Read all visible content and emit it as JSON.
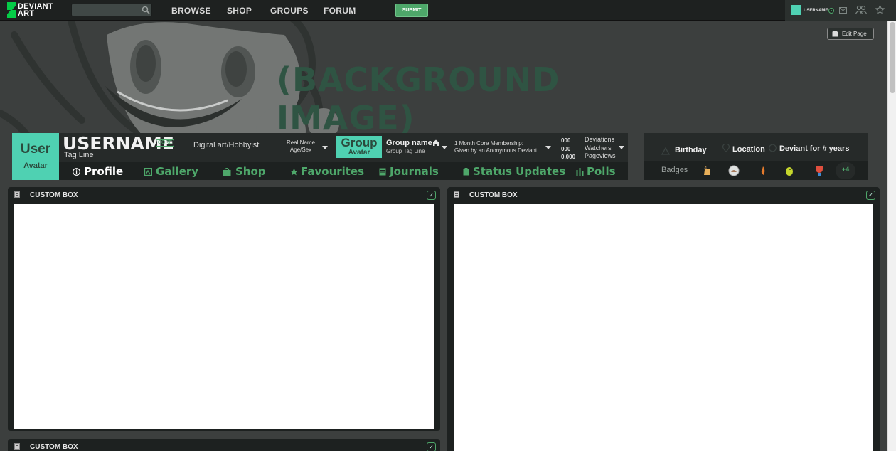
{
  "topbar": {
    "logo_line1": "DEVIANT",
    "logo_line2": "ART",
    "search_placeholder": "",
    "nav": [
      "BROWSE",
      "SHOP",
      "GROUPS",
      "FORUM"
    ],
    "submit": "SUBMIT",
    "username": "USERNAME",
    "icons": [
      "search-icon",
      "mail-icon",
      "watch-icon",
      "star-icon"
    ],
    "accent": "#4ea76a"
  },
  "banner": {
    "text": "(BACKGROUND IMAGE)",
    "edit_page": "Edit Page"
  },
  "profile": {
    "avatar_line1": "User",
    "avatar_line2": "Avatar",
    "username": "USERNAME",
    "core_badge": "CORE",
    "tagline": "Tag Line",
    "art_status": "Digital art/Hobbyist",
    "real_name": "Real Name",
    "age_sex": "Age/Sex",
    "group_avatar_line1": "Group",
    "group_avatar_line2": "Avatar",
    "group_name": "Group name",
    "group_tagline": "Group Tag Line",
    "membership_line1": "1 Month Core Membership:",
    "membership_line2": "Given by an Anonymous Deviant",
    "stats": [
      {
        "value": "000",
        "label": "Deviations"
      },
      {
        "value": "000",
        "label": "Watchers"
      },
      {
        "value": "0,000",
        "label": "Pageviews"
      }
    ],
    "tabs": [
      "Profile",
      "Gallery",
      "Shop",
      "Favourites",
      "Journals",
      "Status Updates",
      "Polls"
    ],
    "active_tab": "Profile",
    "avatar_color": "#4fd1b2"
  },
  "info": {
    "birthday": "Birthday",
    "location": "Location",
    "deviant_for": "Deviant for  # years",
    "badges_label": "Badges",
    "more_badges": "+4"
  },
  "custom_boxes": [
    {
      "title": "CUSTOM BOX"
    },
    {
      "title": "CUSTOM BOX"
    },
    {
      "title": "CUSTOM BOX"
    }
  ]
}
